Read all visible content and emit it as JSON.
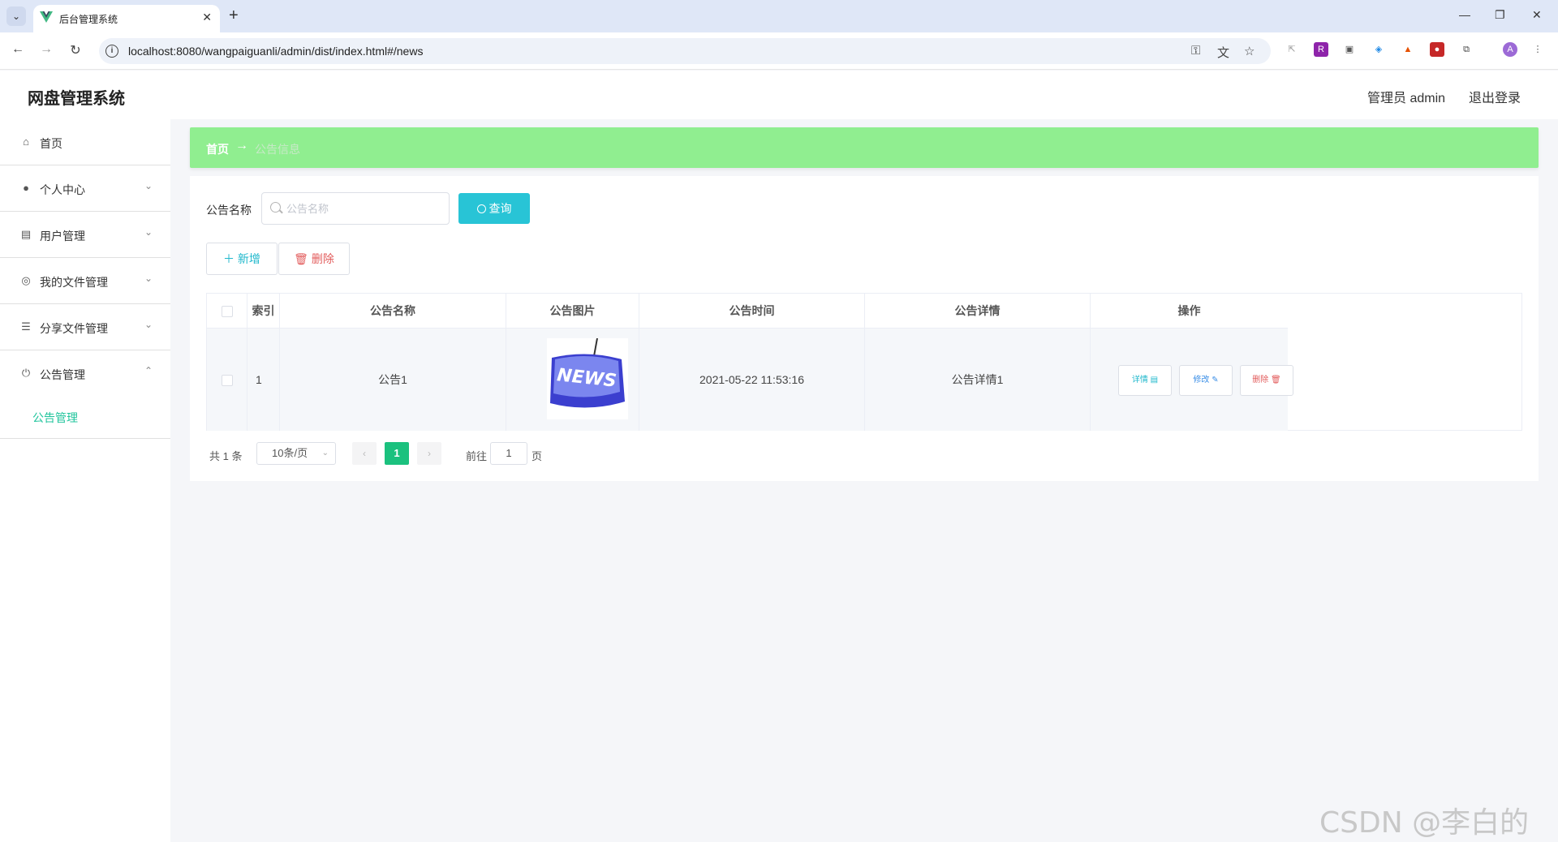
{
  "browser": {
    "tab_title": "后台管理系统",
    "url": "localhost:8080/wangpaiguanli/admin/dist/index.html#/news"
  },
  "header": {
    "app_title": "网盘管理系统",
    "user_label": "管理员 admin",
    "logout_label": "退出登录"
  },
  "sidebar": {
    "items": [
      {
        "label": "首页",
        "icon": "home-icon"
      },
      {
        "label": "个人中心",
        "icon": "user-icon"
      },
      {
        "label": "用户管理",
        "icon": "clipboard-icon"
      },
      {
        "label": "我的文件管理",
        "icon": "compass-icon"
      },
      {
        "label": "分享文件管理",
        "icon": "list-icon"
      },
      {
        "label": "公告管理",
        "icon": "power-icon"
      }
    ],
    "active_submenu": "公告管理"
  },
  "breadcrumb": {
    "home": "首页",
    "current": "公告信息"
  },
  "search": {
    "label": "公告名称",
    "placeholder": "公告名称",
    "button": "查询"
  },
  "actions": {
    "add": "＋ 新增",
    "delete": "删除"
  },
  "table": {
    "headers": [
      "索引",
      "公告名称",
      "公告图片",
      "公告时间",
      "公告详情",
      "操作"
    ],
    "rows": [
      {
        "index": "1",
        "name": "公告1",
        "image_text": "NEWS",
        "time": "2021-05-22 11:53:16",
        "detail": "公告详情1",
        "ops": [
          "详情",
          "修改",
          "删除"
        ]
      }
    ]
  },
  "pagination": {
    "total": "共 1 条",
    "page_size": "10条/页",
    "current": "1",
    "goto_prefix": "前往",
    "goto_value": "1",
    "goto_suffix": "页"
  },
  "watermark": "CSDN @李白的粉",
  "colors": {
    "accent": "#20c49c",
    "breadcrumb_bg": "#90ee90",
    "query_btn": "#28c4d6",
    "danger": "#e25b5b",
    "pager_active": "#1bc17e"
  }
}
